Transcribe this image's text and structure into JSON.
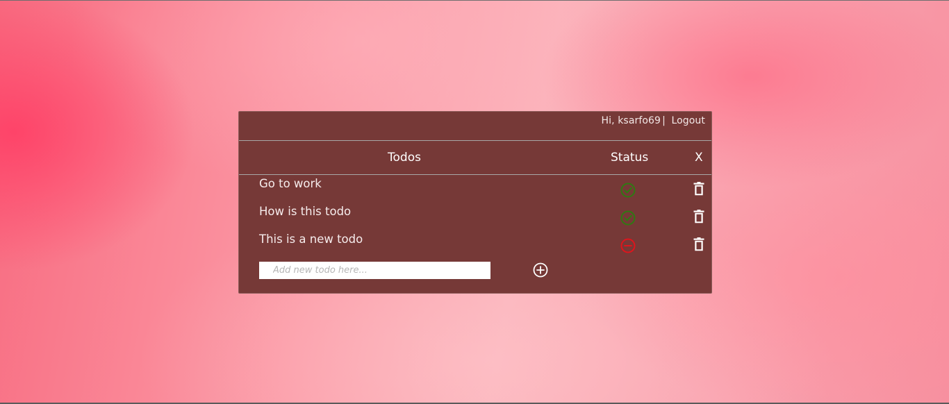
{
  "user": {
    "greeting": "Hi, ksarfo69",
    "separator": "|",
    "logout_label": "Logout"
  },
  "table": {
    "todos_header": "Todos",
    "status_header": "Status",
    "close_label": "X"
  },
  "todos": [
    {
      "text": "Go to work",
      "status": "complete",
      "status_icon": "check-circle-icon"
    },
    {
      "text": "How is this todo",
      "status": "complete",
      "status_icon": "check-circle-icon"
    },
    {
      "text": "This is a new todo",
      "status": "incomplete",
      "status_icon": "minus-circle-icon"
    }
  ],
  "new_todo": {
    "placeholder": "Add new todo here...",
    "value": "",
    "add_icon": "plus-circle-icon"
  },
  "colors": {
    "panel_bg": "#763937",
    "complete": "#2f7a12",
    "incomplete": "#e0141c",
    "text": "#ffffff"
  }
}
